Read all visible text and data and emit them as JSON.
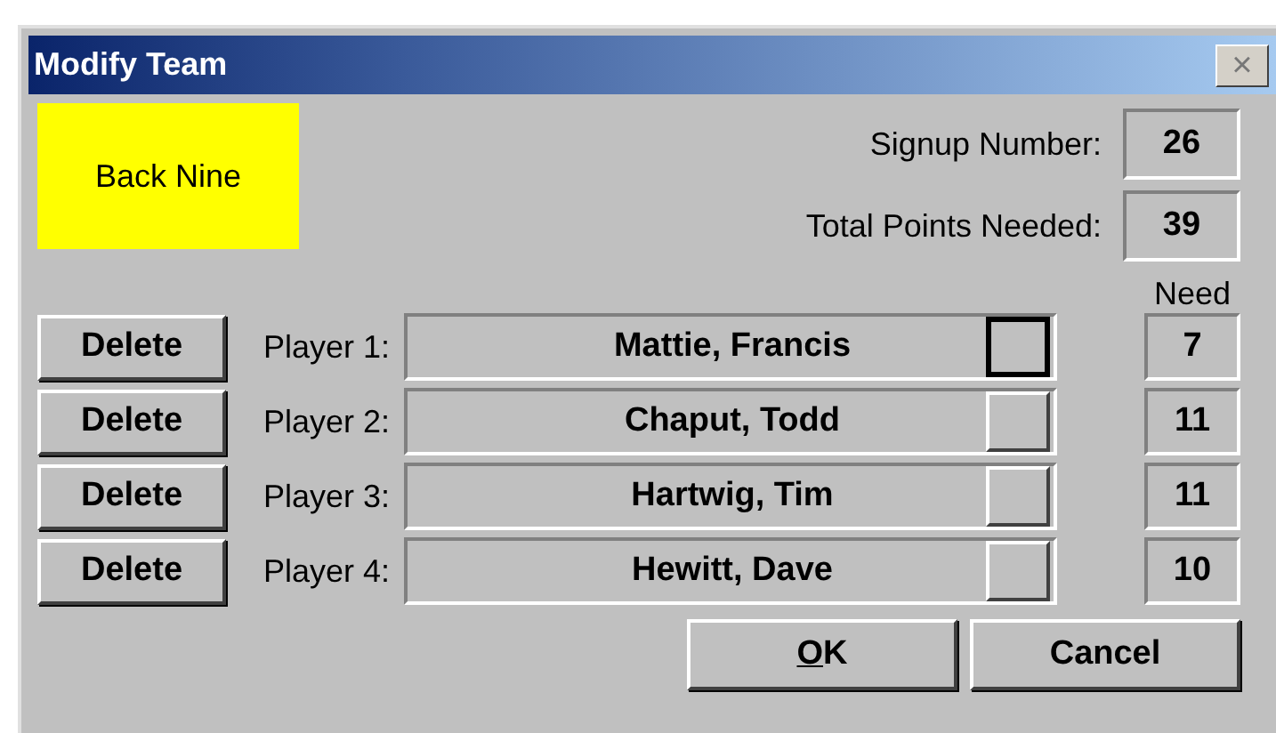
{
  "window": {
    "title": "Modify Team",
    "close": "×"
  },
  "team_name": "Back Nine",
  "stats": [
    {
      "label": "Signup Number:",
      "value": "26"
    },
    {
      "label": "Total Points Needed:",
      "value": "39"
    }
  ],
  "need_heading": "Need",
  "players": [
    {
      "delete": "Delete",
      "label": "Player 1:",
      "name": "Mattie, Francis",
      "focused": true,
      "need": "7"
    },
    {
      "delete": "Delete",
      "label": "Player 2:",
      "name": "Chaput, Todd",
      "focused": false,
      "need": "11"
    },
    {
      "delete": "Delete",
      "label": "Player 3:",
      "name": "Hartwig, Tim",
      "focused": false,
      "need": "11"
    },
    {
      "delete": "Delete",
      "label": "Player 4:",
      "name": "Hewitt, Dave",
      "focused": false,
      "need": "10"
    }
  ],
  "buttons": [
    {
      "label": "OK",
      "underline_first": true
    },
    {
      "label": "Cancel",
      "underline_first": false
    }
  ]
}
